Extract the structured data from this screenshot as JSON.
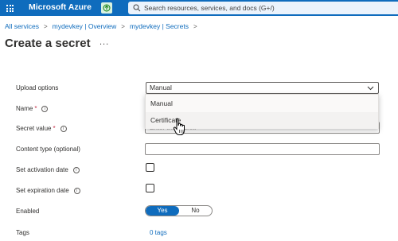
{
  "topbar": {
    "brand": "Microsoft Azure",
    "search_placeholder": "Search resources, services, and docs (G+/)",
    "colors": {
      "bar": "#0f6cbd",
      "search_bg": "#ebf3fc"
    }
  },
  "breadcrumb": {
    "items": [
      "All services",
      "mydevkey | Overview",
      "mydevkey | Secrets"
    ],
    "separator": ">"
  },
  "page": {
    "title": "Create a secret",
    "more_label": "..."
  },
  "form": {
    "upload_options": {
      "label": "Upload options",
      "value": "Manual",
      "options": [
        "Manual",
        "Certificate"
      ]
    },
    "name": {
      "label": "Name",
      "required_mark": "*"
    },
    "secret_value": {
      "label": "Secret value",
      "required_mark": "*",
      "placeholder": "Enter the secret."
    },
    "content_type": {
      "label": "Content type (optional)",
      "value": ""
    },
    "activation_date": {
      "label": "Set activation date",
      "checked": false
    },
    "expiration_date": {
      "label": "Set expiration date",
      "checked": false
    },
    "enabled": {
      "label": "Enabled",
      "yes": "Yes",
      "no": "No",
      "selected": "Yes"
    },
    "tags": {
      "label": "Tags",
      "value": "0 tags"
    }
  },
  "icons": {
    "info": "info-icon",
    "chevron": "chevron-down-icon",
    "search": "search-icon",
    "cursor": "hand-pointer-icon"
  }
}
